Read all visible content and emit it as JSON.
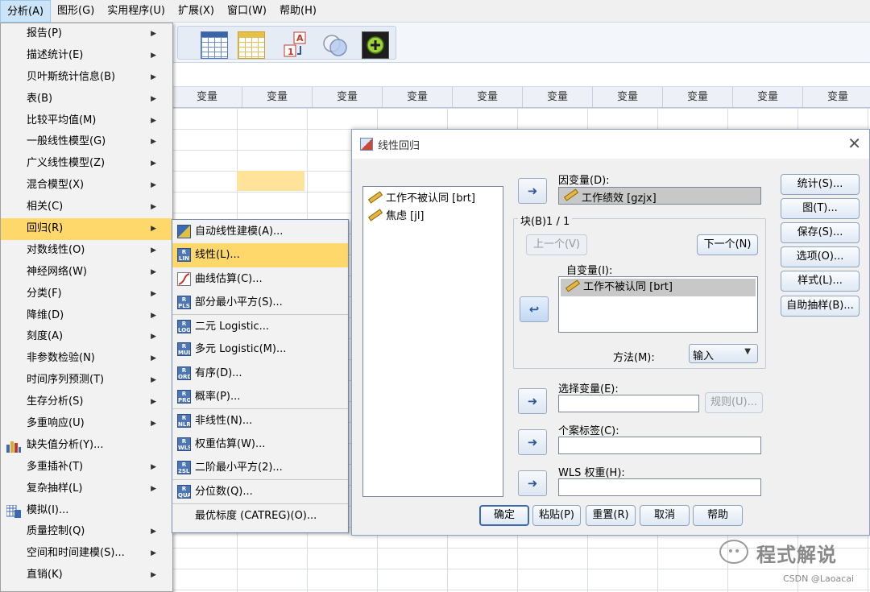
{
  "menubar": {
    "items": [
      "分析(A)",
      "图形(G)",
      "实用程序(U)",
      "扩展(X)",
      "窗口(W)",
      "帮助(H)"
    ]
  },
  "grid": {
    "column_header": "变量"
  },
  "analyze_menu": {
    "items": [
      {
        "label": "报告(P)",
        "submenu": true
      },
      {
        "label": "描述统计(E)",
        "submenu": true
      },
      {
        "label": "贝叶斯统计信息(B)",
        "submenu": true
      },
      {
        "label": "表(B)",
        "submenu": true
      },
      {
        "label": "比较平均值(M)",
        "submenu": true
      },
      {
        "label": "一般线性模型(G)",
        "submenu": true
      },
      {
        "label": "广义线性模型(Z)",
        "submenu": true
      },
      {
        "label": "混合模型(X)",
        "submenu": true
      },
      {
        "label": "相关(C)",
        "submenu": true
      },
      {
        "label": "回归(R)",
        "submenu": true,
        "highlighted": true
      },
      {
        "label": "对数线性(O)",
        "submenu": true
      },
      {
        "label": "神经网络(W)",
        "submenu": true
      },
      {
        "label": "分类(F)",
        "submenu": true
      },
      {
        "label": "降维(D)",
        "submenu": true
      },
      {
        "label": "刻度(A)",
        "submenu": true
      },
      {
        "label": "非参数检验(N)",
        "submenu": true
      },
      {
        "label": "时间序列预测(T)",
        "submenu": true
      },
      {
        "label": "生存分析(S)",
        "submenu": true
      },
      {
        "label": "多重响应(U)",
        "submenu": true
      },
      {
        "label": "缺失值分析(Y)...",
        "icon": "missing-values-icon"
      },
      {
        "label": "多重插补(T)",
        "submenu": true
      },
      {
        "label": "复杂抽样(L)",
        "submenu": true
      },
      {
        "label": "模拟(I)...",
        "icon": "simulation-icon"
      },
      {
        "label": "质量控制(Q)",
        "submenu": true
      },
      {
        "label": "空间和时间建模(S)...",
        "submenu": true
      },
      {
        "label": "直销(K)",
        "submenu": true
      }
    ]
  },
  "regression_menu": {
    "items": [
      {
        "label": "自动线性建模(A)...",
        "icon": "auto-linear-icon"
      },
      {
        "label": "线性(L)...",
        "icon": "linear-icon",
        "highlighted": true
      },
      {
        "label": "曲线估算(C)...",
        "icon": "curve-estimation-icon"
      },
      {
        "label": "部分最小平方(S)...",
        "icon": "partial-least-squares-icon"
      },
      {
        "label": "二元 Logistic...",
        "icon": "binary-logistic-icon",
        "separator": true
      },
      {
        "label": "多元 Logistic(M)...",
        "icon": "multinomial-logistic-icon"
      },
      {
        "label": "有序(D)...",
        "icon": "ordinal-icon"
      },
      {
        "label": "概率(P)...",
        "icon": "probit-icon"
      },
      {
        "label": "非线性(N)...",
        "icon": "nonlinear-icon",
        "separator": true
      },
      {
        "label": "权重估算(W)...",
        "icon": "weight-estimation-icon"
      },
      {
        "label": "二阶最小平方(2)...",
        "icon": "two-stage-least-squares-icon"
      },
      {
        "label": "分位数(Q)...",
        "icon": "quantile-icon",
        "separator": true
      },
      {
        "label": "最优标度 (CATREG)(O)...",
        "separator": true
      }
    ]
  },
  "dialog": {
    "title": "线性回归",
    "source_variables": [
      "工作不被认同 [brt]",
      "焦虑 [jl]"
    ],
    "dependent_label": "因变量(D):",
    "dependent_value": "工作绩效 [gzjx]",
    "block_label": "块(B)1 / 1",
    "prev_button": "上一个(V)",
    "next_button": "下一个(N)",
    "independent_label": "自变量(I):",
    "independent_values": [
      "工作不被认同 [brt]"
    ],
    "method_label": "方法(M):",
    "method_value": "输入",
    "selection_label": "选择变量(E):",
    "rule_button": "规则(U)...",
    "case_label": "个案标签(C):",
    "wls_label": "WLS 权重(H):",
    "side_buttons": [
      "统计(S)...",
      "图(T)...",
      "保存(S)...",
      "选项(O)...",
      "样式(L)...",
      "自助抽样(B)..."
    ],
    "bottom_buttons": [
      "确定",
      "粘贴(P)",
      "重置(R)",
      "取消",
      "帮助"
    ]
  },
  "watermark": {
    "text": "程式解说",
    "credit": "CSDN @Laoacai"
  }
}
